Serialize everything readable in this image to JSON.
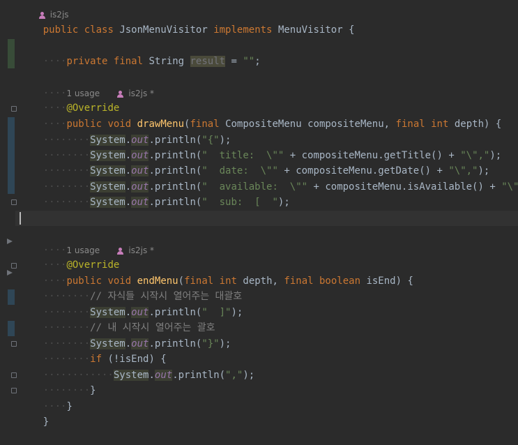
{
  "top_hint": "is2js",
  "class_decl": {
    "kw1": "public",
    "kw2": "class",
    "name": "JsonMenuVisitor",
    "kw3": "implements",
    "iface": "MenuVisitor",
    "brace": " {"
  },
  "field": {
    "kw1": "private",
    "kw2": "final",
    "type": "String",
    "name": "result",
    "rest": " = ",
    "value": "\"\"",
    ";": ";"
  },
  "hint1": {
    "usage": "1 usage",
    "author": "is2js *"
  },
  "override": "@Override",
  "draw": {
    "kw1": "public",
    "kw2": "void",
    "name": "drawMenu",
    "open": "(",
    "fin": "final",
    "ptype": "CompositeMenu",
    "pname": "compositeMenu",
    "comma": ", ",
    "fin2": "final",
    "int": "int",
    "depth": "depth",
    "close": ") {"
  },
  "draw_lines": [
    {
      "sys": "System",
      "out": "out",
      "pre": ".println(",
      "s1": "\"{\"",
      "post": ");"
    },
    {
      "sys": "System",
      "out": "out",
      "pre": ".println(",
      "s1": "\"  title:  \\\"\"",
      "mid": " + compositeMenu.getTitle() + ",
      "s2": "\"\\\",\"",
      "post": ");"
    },
    {
      "sys": "System",
      "out": "out",
      "pre": ".println(",
      "s1": "\"  date:  \\\"\"",
      "mid": " + compositeMenu.getDate() + ",
      "s2": "\"\\\",\"",
      "post": ");"
    },
    {
      "sys": "System",
      "out": "out",
      "pre": ".println(",
      "s1": "\"  available:  \\\"\"",
      "mid": " + compositeMenu.isAvailable() + ",
      "s2": "\"\\\",\"",
      "post": ");"
    },
    {
      "sys": "System",
      "out": "out",
      "pre": ".println(",
      "s1": "\"  sub:  [  \"",
      "post": ");"
    }
  ],
  "close_brace": "}",
  "hint2": {
    "usage": "1 usage",
    "author": "is2js *"
  },
  "end": {
    "kw1": "public",
    "kw2": "void",
    "name": "endMenu",
    "open": "(",
    "fin": "final",
    "int": "int",
    "p1": "depth",
    "comma": ", ",
    "fin2": "final",
    "bool": "boolean",
    "p2": "isEnd",
    "close": ") {"
  },
  "comment1": "// 자식들 시작시 열어주는 대괄호",
  "end_line1": {
    "sys": "System",
    "out": "out",
    "pre": ".println(",
    "s1": "\"  ]\"",
    "post": ");"
  },
  "comment2": "// 내 시작시 열어주는 괄호",
  "end_line2": {
    "sys": "System",
    "out": "out",
    "pre": ".println(",
    "s1": "\"}\"",
    "post": ");"
  },
  "if_line": {
    "kw": "if",
    "rest": " (!isEnd) {"
  },
  "end_line3": {
    "sys": "System",
    "out": "out",
    "pre": ".println(",
    "s1": "\",\"",
    "post": ");"
  }
}
